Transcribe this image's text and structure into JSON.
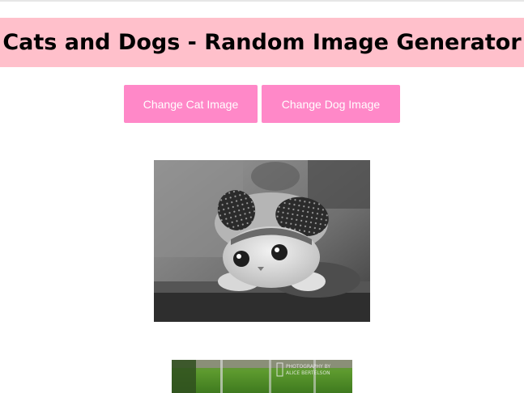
{
  "header": {
    "title": "Cats and Dogs - Random Image Generator"
  },
  "buttons": {
    "cat_label": "Change Cat Image",
    "dog_label": "Change Dog Image"
  },
  "images": {
    "cat_watermark": "",
    "dog_watermark_line1": "PHOTOGRAPHY BY",
    "dog_watermark_line2": "ALICE BERTELSON"
  },
  "colors": {
    "banner_bg": "#ffc0cb",
    "button_bg": "#ff88c8",
    "button_text": "#ffffff"
  }
}
